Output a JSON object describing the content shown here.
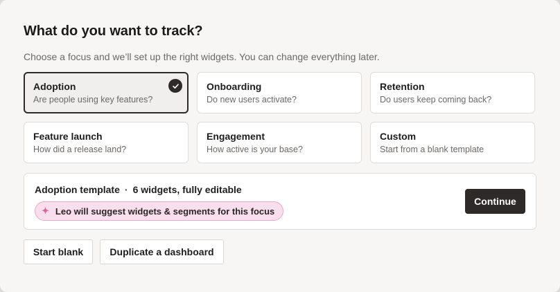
{
  "dialog": {
    "title": "What do you want to track?",
    "subtitle": "Choose a focus and we’ll set up the right widgets. You can change everything later."
  },
  "focus_options": [
    {
      "title": "Adoption",
      "description": "Are people using key features?",
      "selected": true
    },
    {
      "title": "Onboarding",
      "description": "Do new users activate?",
      "selected": false
    },
    {
      "title": "Retention",
      "description": "Do users keep coming back?",
      "selected": false
    },
    {
      "title": "Feature launch",
      "description": "How did a release land?",
      "selected": false
    },
    {
      "title": "Engagement",
      "description": "How active is your base?",
      "selected": false
    },
    {
      "title": "Custom",
      "description": "Start from a blank template",
      "selected": false
    }
  ],
  "summary": {
    "template_name": "Adoption template",
    "separator": "·",
    "detail": "6 widgets, fully editable",
    "leo_text": "Leo will suggest widgets & segments for this focus",
    "leo_icon": "sparkle-icon",
    "continue_label": "Continue"
  },
  "footer": {
    "start_blank_label": "Start blank",
    "duplicate_label": "Duplicate a dashboard"
  },
  "colors": {
    "primary": "#2d2a27",
    "leo_badge_bg": "#f9dfee",
    "leo_badge_border": "#eaa6c8",
    "leo_sparkle": "#e0609a"
  }
}
